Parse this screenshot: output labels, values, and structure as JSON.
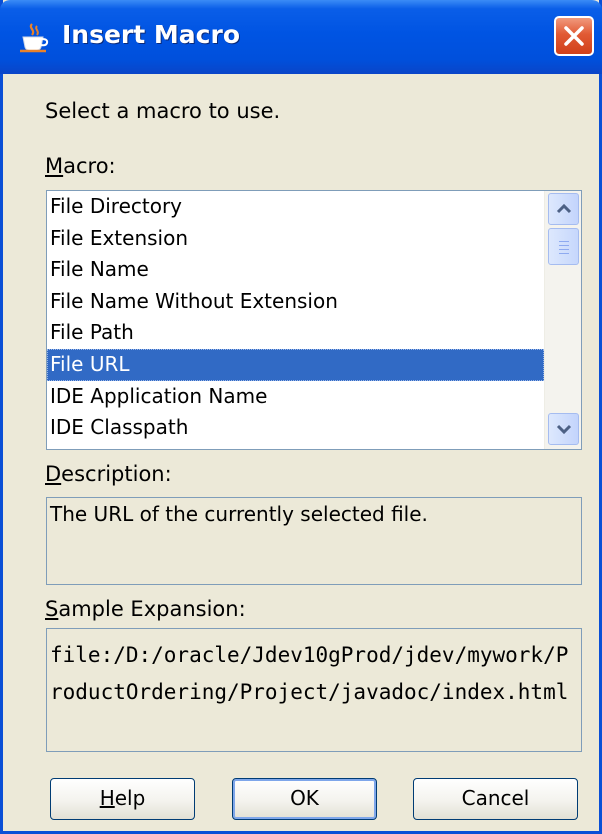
{
  "window": {
    "title": "Insert Macro",
    "title_icon": "java-cup-icon",
    "close_icon": "close-icon"
  },
  "prompt": "Select a macro to use.",
  "macro": {
    "label_mnemonic": "M",
    "label_rest": "acro:",
    "items": [
      "File Directory",
      "File Extension",
      "File Name",
      "File Name Without Extension",
      "File Path",
      "File URL",
      "IDE Application Name",
      "IDE Classpath"
    ],
    "selected_index": 5,
    "scroll_up_icon": "chevron-up-icon",
    "scroll_down_icon": "chevron-down-icon"
  },
  "description": {
    "label_mnemonic": "D",
    "label_rest": "escription:",
    "text": "The URL of the currently selected file."
  },
  "sample": {
    "label_mnemonic": "S",
    "label_rest": "ample Expansion:",
    "text": "file:/D:/oracle/Jdev10gProd/jdev/mywork/ProductOrdering/Project/javadoc/index.html"
  },
  "buttons": {
    "help_mnemonic": "H",
    "help_rest": "elp",
    "ok": "OK",
    "cancel": "Cancel"
  },
  "colors": {
    "titlebar": "#0054e3",
    "selection": "#316ac5",
    "dialog_bg": "#ece9d8",
    "close_button": "#e15a34"
  }
}
